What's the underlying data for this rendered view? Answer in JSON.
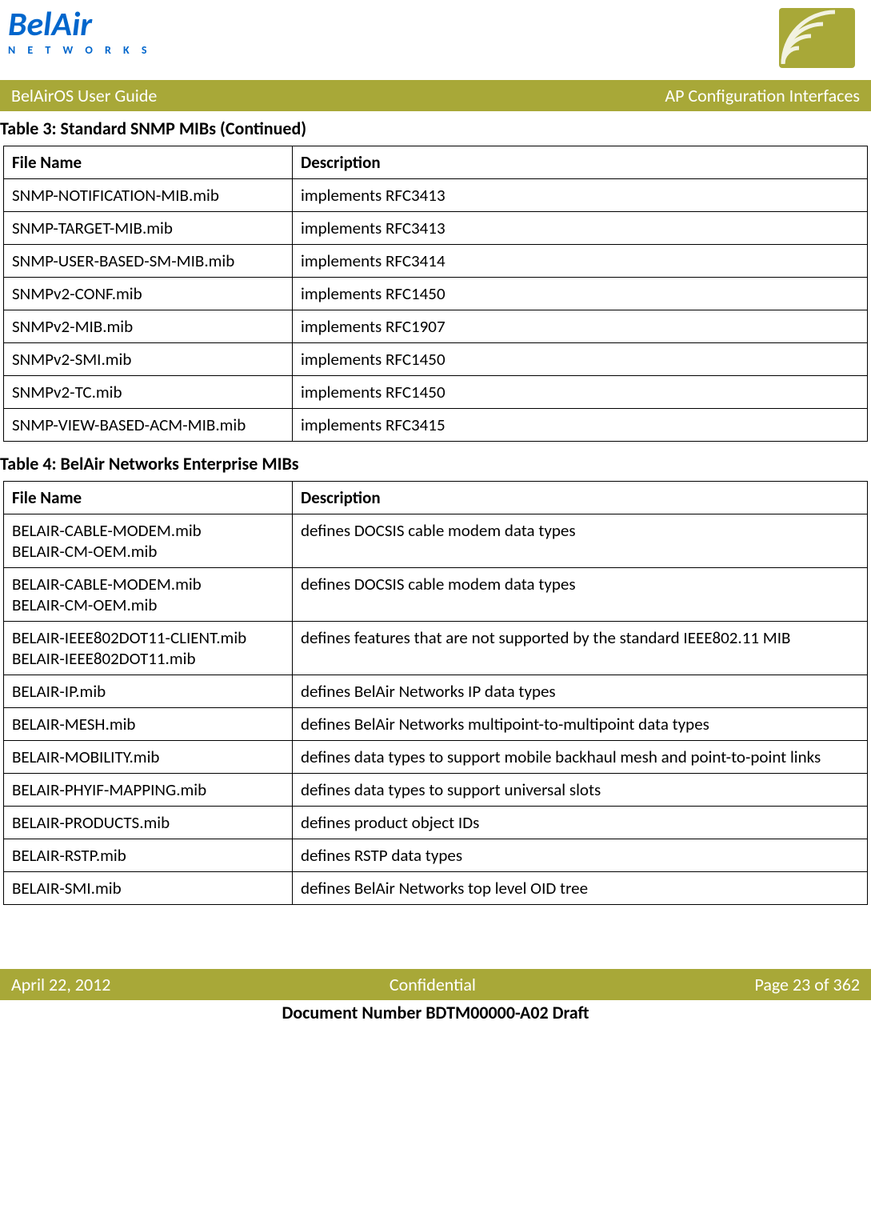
{
  "header": {
    "logo_main": "BelAir",
    "logo_sub": "N E T W O R K S",
    "title_left": "BelAirOS User Guide",
    "title_right": "AP Configuration Interfaces"
  },
  "table3": {
    "caption": "Table 3: Standard SNMP MIBs  (Continued)",
    "headers": {
      "c1": "File Name",
      "c2": "Description"
    },
    "rows": [
      {
        "c1": "SNMP-NOTIFICATION-MIB.mib",
        "c2": "implements RFC3413"
      },
      {
        "c1": "SNMP-TARGET-MIB.mib",
        "c2": "implements RFC3413"
      },
      {
        "c1": "SNMP-USER-BASED-SM-MIB.mib",
        "c2": "implements RFC3414"
      },
      {
        "c1": "SNMPv2-CONF.mib",
        "c2": "implements RFC1450"
      },
      {
        "c1": "SNMPv2-MIB.mib",
        "c2": "implements RFC1907"
      },
      {
        "c1": "SNMPv2-SMI.mib",
        "c2": "implements RFC1450"
      },
      {
        "c1": "SNMPv2-TC.mib",
        "c2": "implements RFC1450"
      },
      {
        "c1": "SNMP-VIEW-BASED-ACM-MIB.mib",
        "c2": "implements RFC3415"
      }
    ]
  },
  "table4": {
    "caption": "Table 4: BelAir Networks Enterprise MIBs",
    "headers": {
      "c1": "File Name",
      "c2": "Description"
    },
    "rows": [
      {
        "c1": "BELAIR-CABLE-MODEM.mib\nBELAIR-CM-OEM.mib",
        "c2": "defines DOCSIS cable modem data types"
      },
      {
        "c1": "BELAIR-CABLE-MODEM.mib\nBELAIR-CM-OEM.mib",
        "c2": "defines DOCSIS cable modem data types"
      },
      {
        "c1": "BELAIR-IEEE802DOT11-CLIENT.mib\nBELAIR-IEEE802DOT11.mib",
        "c2": "defines features that are not supported by the standard IEEE802.11 MIB"
      },
      {
        "c1": "BELAIR-IP.mib",
        "c2": "defines BelAir Networks IP data types"
      },
      {
        "c1": "BELAIR-MESH.mib",
        "c2": "defines BelAir Networks multipoint-to-multipoint data types"
      },
      {
        "c1": "BELAIR-MOBILITY.mib",
        "c2": "defines data types to support mobile backhaul mesh and point-to-point links"
      },
      {
        "c1": "BELAIR-PHYIF-MAPPING.mib",
        "c2": "defines data types to support universal slots"
      },
      {
        "c1": "BELAIR-PRODUCTS.mib",
        "c2": "defines product object IDs"
      },
      {
        "c1": "BELAIR-RSTP.mib",
        "c2": "defines RSTP data types"
      },
      {
        "c1": "BELAIR-SMI.mib",
        "c2": "defines BelAir Networks top level OID tree"
      }
    ]
  },
  "footer": {
    "left": "April 22, 2012",
    "center": "Confidential",
    "right": "Page 23 of 362",
    "docnum": "Document Number BDTM00000-A02 Draft"
  }
}
